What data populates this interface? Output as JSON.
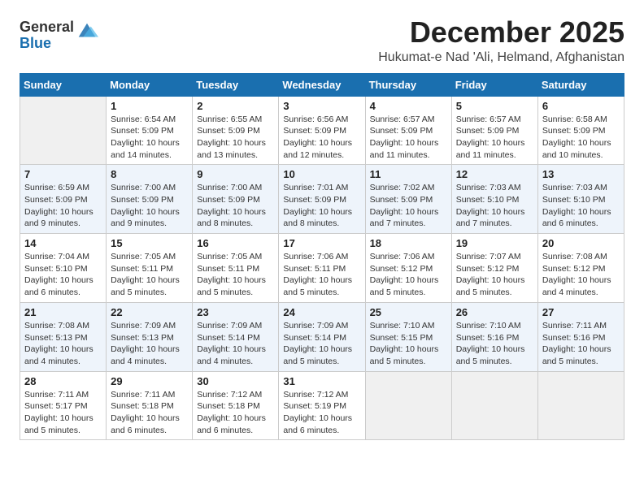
{
  "logo": {
    "general": "General",
    "blue": "Blue"
  },
  "title": "December 2025",
  "location": "Hukumat-e Nad 'Ali, Helmand, Afghanistan",
  "headers": [
    "Sunday",
    "Monday",
    "Tuesday",
    "Wednesday",
    "Thursday",
    "Friday",
    "Saturday"
  ],
  "weeks": [
    [
      {
        "day": "",
        "info": ""
      },
      {
        "day": "1",
        "info": "Sunrise: 6:54 AM\nSunset: 5:09 PM\nDaylight: 10 hours\nand 14 minutes."
      },
      {
        "day": "2",
        "info": "Sunrise: 6:55 AM\nSunset: 5:09 PM\nDaylight: 10 hours\nand 13 minutes."
      },
      {
        "day": "3",
        "info": "Sunrise: 6:56 AM\nSunset: 5:09 PM\nDaylight: 10 hours\nand 12 minutes."
      },
      {
        "day": "4",
        "info": "Sunrise: 6:57 AM\nSunset: 5:09 PM\nDaylight: 10 hours\nand 11 minutes."
      },
      {
        "day": "5",
        "info": "Sunrise: 6:57 AM\nSunset: 5:09 PM\nDaylight: 10 hours\nand 11 minutes."
      },
      {
        "day": "6",
        "info": "Sunrise: 6:58 AM\nSunset: 5:09 PM\nDaylight: 10 hours\nand 10 minutes."
      }
    ],
    [
      {
        "day": "7",
        "info": "Sunrise: 6:59 AM\nSunset: 5:09 PM\nDaylight: 10 hours\nand 9 minutes."
      },
      {
        "day": "8",
        "info": "Sunrise: 7:00 AM\nSunset: 5:09 PM\nDaylight: 10 hours\nand 9 minutes."
      },
      {
        "day": "9",
        "info": "Sunrise: 7:00 AM\nSunset: 5:09 PM\nDaylight: 10 hours\nand 8 minutes."
      },
      {
        "day": "10",
        "info": "Sunrise: 7:01 AM\nSunset: 5:09 PM\nDaylight: 10 hours\nand 8 minutes."
      },
      {
        "day": "11",
        "info": "Sunrise: 7:02 AM\nSunset: 5:09 PM\nDaylight: 10 hours\nand 7 minutes."
      },
      {
        "day": "12",
        "info": "Sunrise: 7:03 AM\nSunset: 5:10 PM\nDaylight: 10 hours\nand 7 minutes."
      },
      {
        "day": "13",
        "info": "Sunrise: 7:03 AM\nSunset: 5:10 PM\nDaylight: 10 hours\nand 6 minutes."
      }
    ],
    [
      {
        "day": "14",
        "info": "Sunrise: 7:04 AM\nSunset: 5:10 PM\nDaylight: 10 hours\nand 6 minutes."
      },
      {
        "day": "15",
        "info": "Sunrise: 7:05 AM\nSunset: 5:11 PM\nDaylight: 10 hours\nand 5 minutes."
      },
      {
        "day": "16",
        "info": "Sunrise: 7:05 AM\nSunset: 5:11 PM\nDaylight: 10 hours\nand 5 minutes."
      },
      {
        "day": "17",
        "info": "Sunrise: 7:06 AM\nSunset: 5:11 PM\nDaylight: 10 hours\nand 5 minutes."
      },
      {
        "day": "18",
        "info": "Sunrise: 7:06 AM\nSunset: 5:12 PM\nDaylight: 10 hours\nand 5 minutes."
      },
      {
        "day": "19",
        "info": "Sunrise: 7:07 AM\nSunset: 5:12 PM\nDaylight: 10 hours\nand 5 minutes."
      },
      {
        "day": "20",
        "info": "Sunrise: 7:08 AM\nSunset: 5:12 PM\nDaylight: 10 hours\nand 4 minutes."
      }
    ],
    [
      {
        "day": "21",
        "info": "Sunrise: 7:08 AM\nSunset: 5:13 PM\nDaylight: 10 hours\nand 4 minutes."
      },
      {
        "day": "22",
        "info": "Sunrise: 7:09 AM\nSunset: 5:13 PM\nDaylight: 10 hours\nand 4 minutes."
      },
      {
        "day": "23",
        "info": "Sunrise: 7:09 AM\nSunset: 5:14 PM\nDaylight: 10 hours\nand 4 minutes."
      },
      {
        "day": "24",
        "info": "Sunrise: 7:09 AM\nSunset: 5:14 PM\nDaylight: 10 hours\nand 5 minutes."
      },
      {
        "day": "25",
        "info": "Sunrise: 7:10 AM\nSunset: 5:15 PM\nDaylight: 10 hours\nand 5 minutes."
      },
      {
        "day": "26",
        "info": "Sunrise: 7:10 AM\nSunset: 5:16 PM\nDaylight: 10 hours\nand 5 minutes."
      },
      {
        "day": "27",
        "info": "Sunrise: 7:11 AM\nSunset: 5:16 PM\nDaylight: 10 hours\nand 5 minutes."
      }
    ],
    [
      {
        "day": "28",
        "info": "Sunrise: 7:11 AM\nSunset: 5:17 PM\nDaylight: 10 hours\nand 5 minutes."
      },
      {
        "day": "29",
        "info": "Sunrise: 7:11 AM\nSunset: 5:18 PM\nDaylight: 10 hours\nand 6 minutes."
      },
      {
        "day": "30",
        "info": "Sunrise: 7:12 AM\nSunset: 5:18 PM\nDaylight: 10 hours\nand 6 minutes."
      },
      {
        "day": "31",
        "info": "Sunrise: 7:12 AM\nSunset: 5:19 PM\nDaylight: 10 hours\nand 6 minutes."
      },
      {
        "day": "",
        "info": ""
      },
      {
        "day": "",
        "info": ""
      },
      {
        "day": "",
        "info": ""
      }
    ]
  ]
}
